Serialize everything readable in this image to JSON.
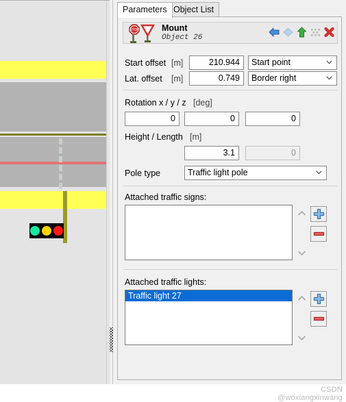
{
  "tabs": [
    {
      "label": "Parameters",
      "active": true
    },
    {
      "label": "Object List",
      "active": false
    }
  ],
  "object_header": {
    "title": "Mount",
    "subtitle": "Object 26",
    "icons": [
      "stop-sign-icon",
      "yield-sign-icon"
    ],
    "tools": [
      "previous-arrow-icon",
      "duplicate-icon",
      "move-up-arrow-icon",
      "grid-icon",
      "delete-icon"
    ]
  },
  "fields": {
    "start_offset": {
      "label": "Start offset",
      "unit": "[m]",
      "value": "210.944",
      "reference": "Start point"
    },
    "lat_offset": {
      "label": "Lat. offset",
      "unit": "[m]",
      "value": "0.749",
      "reference": "Border right"
    },
    "rotation": {
      "label": "Rotation x / y / z",
      "unit": "[deg]",
      "x": "0",
      "y": "0",
      "z": "0"
    },
    "height_length": {
      "label": "Height / Length",
      "unit": "[m]",
      "height": "3.1",
      "length": "0",
      "length_disabled": true
    },
    "pole_type": {
      "label": "Pole type",
      "value": "Traffic light pole"
    }
  },
  "attached_traffic_signs": {
    "label": "Attached traffic signs:",
    "items": [],
    "add_label": "+",
    "remove_label": "-"
  },
  "attached_traffic_lights": {
    "label": "Attached traffic lights:",
    "items": [
      {
        "label": "Traffic light 27",
        "selected": true
      }
    ],
    "add_label": "+",
    "remove_label": "-"
  },
  "watermark": "CSDN @woxiangxinwang",
  "road_view": {
    "colors": {
      "background": "#e4e4e4",
      "asphalt": "#b3b3b3",
      "shoulder_yellow": "#ffff55",
      "reference_line_red": "#e57373",
      "road_edge_olive": "#7f7f22",
      "pole": "#9a9a2b",
      "lane_dash": "#c6cfc9"
    },
    "signal_lamps": [
      "green",
      "yellow",
      "red"
    ]
  }
}
